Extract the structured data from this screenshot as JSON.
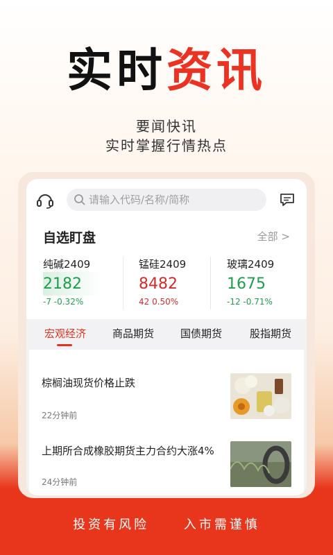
{
  "hero": {
    "title_black": "实时",
    "title_red": "资讯"
  },
  "subtitle": {
    "line1": "要闻快讯",
    "line2": "实时掌握行情热点"
  },
  "search": {
    "placeholder": "请输入代码/名称/简称"
  },
  "watchlist": {
    "title": "自选盯盘",
    "more": "全部 >",
    "quotes": [
      {
        "name": "纯碱2409",
        "price": "2182",
        "change": "-7  -0.32%",
        "trend": "down"
      },
      {
        "name": "锰硅2409",
        "price": "8482",
        "change": "42  0.50%",
        "trend": "up"
      },
      {
        "name": "玻璃2409",
        "price": "1675",
        "change": "-12  -0.71%",
        "trend": "down"
      }
    ]
  },
  "tabs": [
    "宏观经济",
    "商品期货",
    "国债期货",
    "股指期货"
  ],
  "news": [
    {
      "headline": "棕榈油现货价格止跌",
      "time": "22分钟前"
    },
    {
      "headline": "上期所合成橡胶期货主力合约大涨4%",
      "time": "24分钟前"
    }
  ],
  "footer": {
    "left": "投资有风险",
    "right": "入市需谨慎"
  },
  "colors": {
    "accent": "#ea3322",
    "up": "#d12c2c",
    "down": "#1f9d4d"
  }
}
